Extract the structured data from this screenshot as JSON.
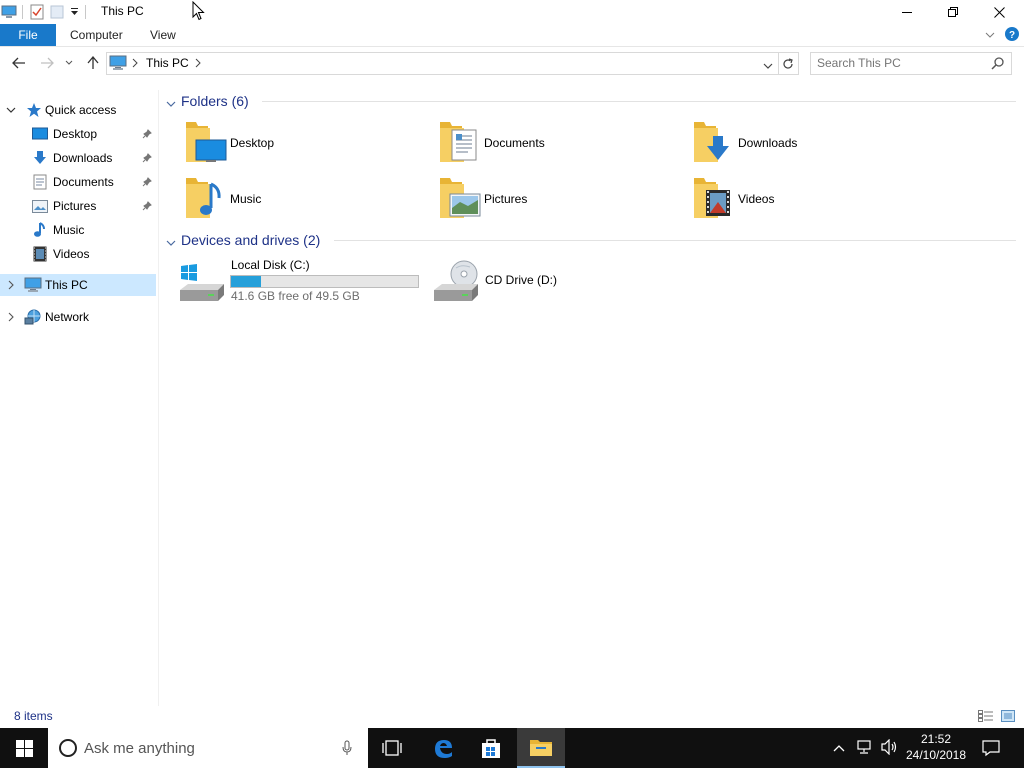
{
  "window": {
    "title": "This PC"
  },
  "ribbon": {
    "tabs": [
      {
        "label": "File"
      },
      {
        "label": "Computer"
      },
      {
        "label": "View"
      }
    ]
  },
  "address": {
    "path": [
      "This PC"
    ],
    "search_placeholder": "Search This PC"
  },
  "navpane": {
    "quick_access": "Quick access",
    "quick_items": [
      {
        "label": "Desktop",
        "icon": "desktop-icon",
        "pinned": true
      },
      {
        "label": "Downloads",
        "icon": "downloads-icon",
        "pinned": true
      },
      {
        "label": "Documents",
        "icon": "documents-icon",
        "pinned": true
      },
      {
        "label": "Pictures",
        "icon": "pictures-icon",
        "pinned": true
      },
      {
        "label": "Music",
        "icon": "music-icon",
        "pinned": false
      },
      {
        "label": "Videos",
        "icon": "videos-icon",
        "pinned": false
      }
    ],
    "this_pc": "This PC",
    "network": "Network"
  },
  "content": {
    "folders_header": "Folders (6)",
    "folders": [
      {
        "label": "Desktop",
        "icon": "desktop-folder-icon"
      },
      {
        "label": "Documents",
        "icon": "documents-folder-icon"
      },
      {
        "label": "Downloads",
        "icon": "downloads-folder-icon"
      },
      {
        "label": "Music",
        "icon": "music-folder-icon"
      },
      {
        "label": "Pictures",
        "icon": "pictures-folder-icon"
      },
      {
        "label": "Videos",
        "icon": "videos-folder-icon"
      }
    ],
    "drives_header": "Devices and drives (2)",
    "drives": [
      {
        "label": "Local Disk (C:)",
        "free_text": "41.6 GB free of 49.5 GB",
        "used_fraction": 0.16
      },
      {
        "label": "CD Drive (D:)"
      }
    ]
  },
  "status": {
    "item_count": "8 items"
  },
  "taskbar": {
    "search_placeholder": "Ask me anything",
    "time": "21:52",
    "date": "24/10/2018"
  },
  "colors": {
    "accent": "#1979ca",
    "selection": "#cce8ff",
    "header_text": "#1e3287",
    "folder": "#f3c654",
    "taskbar": "#101010"
  }
}
